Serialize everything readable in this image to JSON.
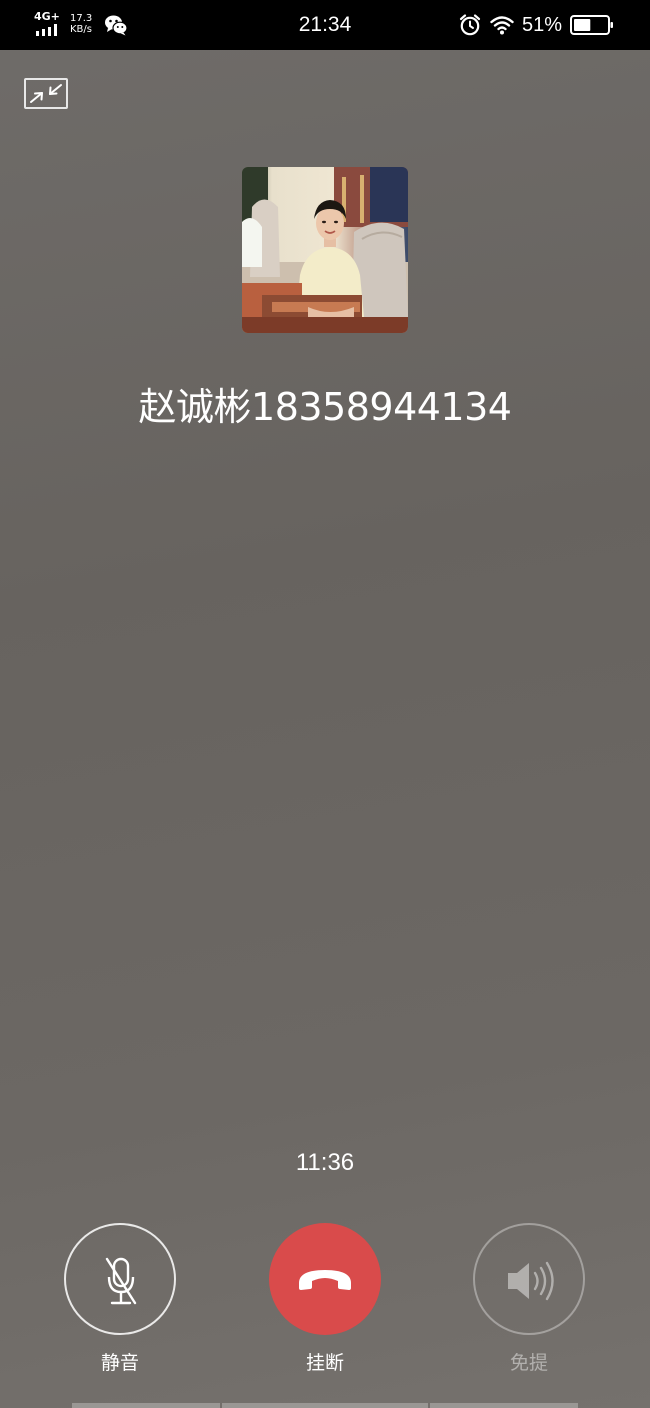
{
  "status_bar": {
    "network_type": "4G+",
    "speed_value": "17.3",
    "speed_unit": "KB/s",
    "time": "21:34",
    "battery_percent": "51%",
    "battery_level": 0.51,
    "icons": [
      "signal-icon",
      "wechat-icon",
      "alarm-icon",
      "wifi-icon",
      "battery-icon"
    ]
  },
  "call": {
    "contact_name": "赵诚彬18358944134",
    "duration": "11:36"
  },
  "controls": {
    "mute_label": "静音",
    "hangup_label": "挂断",
    "speaker_label": "免提"
  },
  "colors": {
    "hangup": "#d94b4b",
    "background": "#6c6864"
  }
}
